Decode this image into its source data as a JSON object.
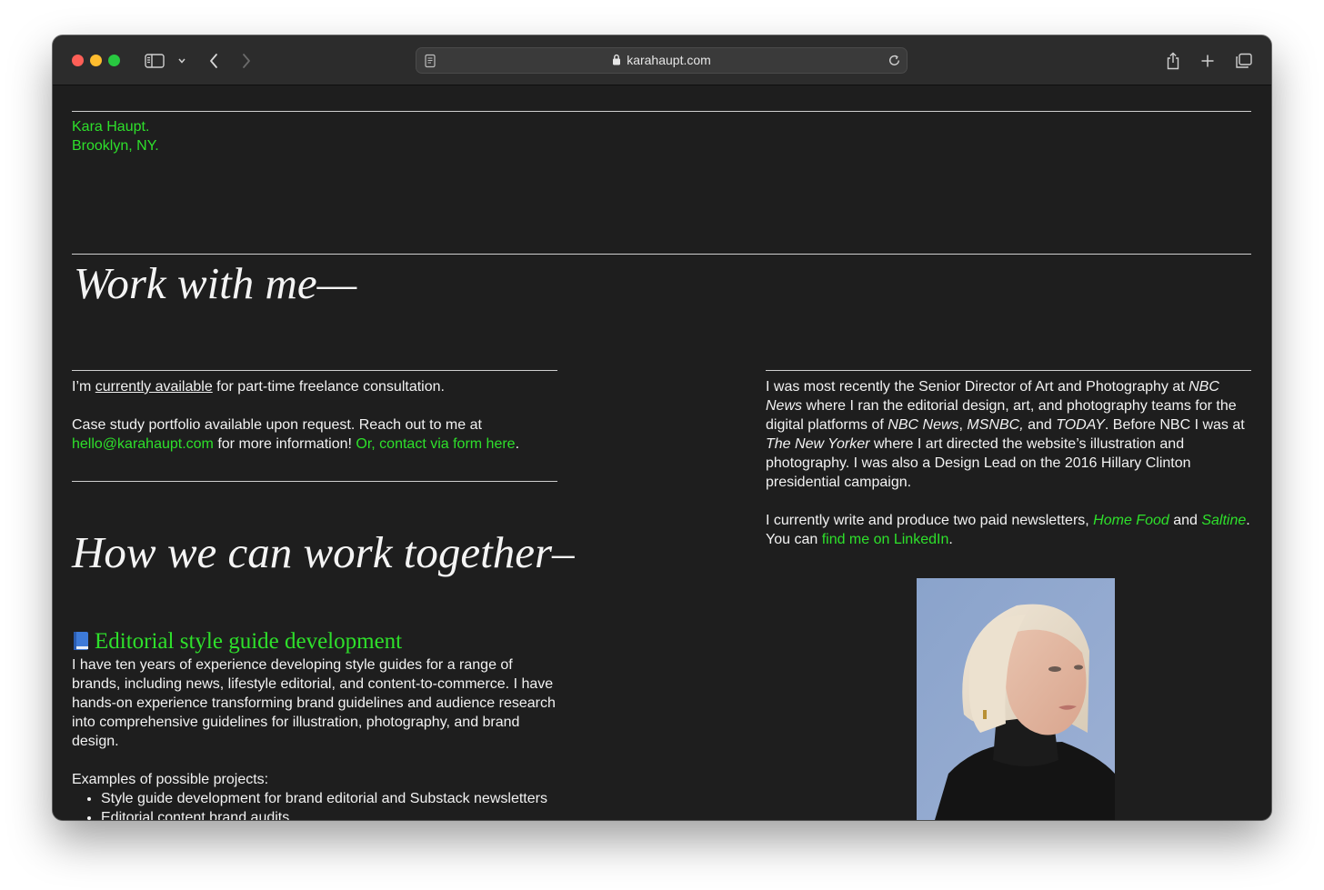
{
  "browser": {
    "url": "karahaupt.com",
    "traffic_colors": {
      "close": "#ff5f57",
      "minimize": "#febc2e",
      "maximize": "#28c840"
    }
  },
  "site": {
    "name": "Kara Haupt.",
    "location": "Brooklyn, NY.",
    "accent_color": "#2ee02b"
  },
  "work": {
    "heading": "Work with me—"
  },
  "availability": {
    "p1_pre": "I’m ",
    "p1_link": "currently available",
    "p1_post": " for part-time freelance consultation.",
    "p2_pre": "Case study portfolio available upon request. Reach out to me at ",
    "email": "hello@karahaupt.com",
    "p2_mid": " for more information! ",
    "form_link": "Or, contact via form here",
    "p2_end": "."
  },
  "together": {
    "heading": "How we can work together–",
    "section_emoji": "📘",
    "section_title": "Editorial style guide development",
    "section_body": "I have ten years of experience developing style guides for a range of brands, including news, lifestyle editorial, and content-to-commerce. I have hands-on experience transforming brand guidelines and audience research into comprehensive guidelines for illustration, photography, and brand design.",
    "examples_label": "Examples of possible projects:",
    "examples": [
      "Style guide development for brand editorial and Substack newsletters",
      "Editorial content brand audits"
    ]
  },
  "bio": {
    "t1": "I was most recently the Senior Director of Art and Photography at ",
    "i1": "NBC News",
    "t2": " where I ran the editorial design, art, and photography teams for the digital platforms of ",
    "i2": "NBC News",
    "t3": ", ",
    "i3": "MSNBC,",
    "t4": " and ",
    "i4": "TODAY",
    "t5": ". Before NBC I was at ",
    "i5": "The New Yorker",
    "t6": " where I art directed the website’s illustration and photography. I was also a Design Lead on the 2016 Hillary Clinton presidential campaign.",
    "n1": "I currently write and produce two paid newsletters, ",
    "nl1": "Home Food",
    "n2": " and ",
    "nl2": "Saltine",
    "n3": ". You can ",
    "linkedin": "find me on LinkedIn",
    "n4": "."
  }
}
